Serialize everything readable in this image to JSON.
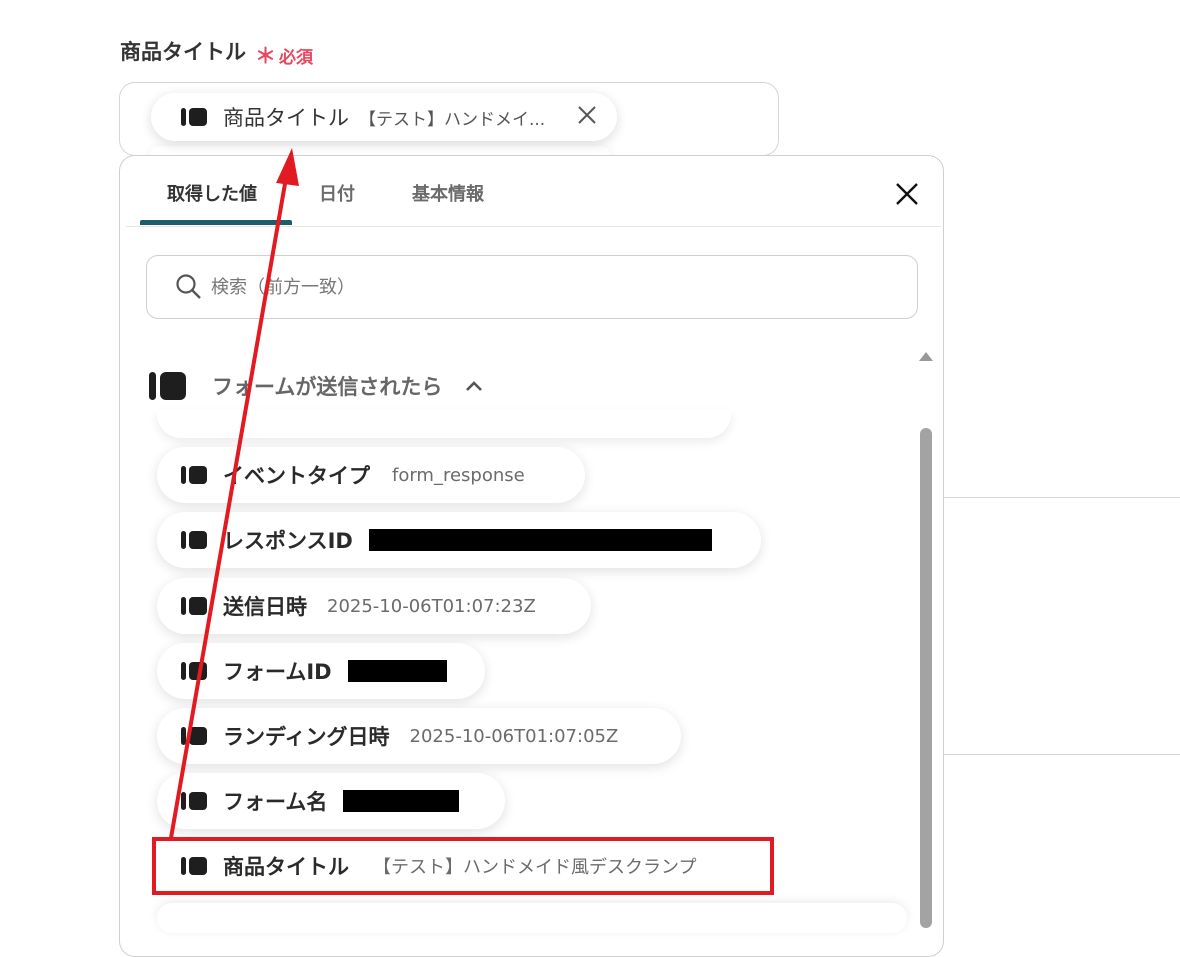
{
  "field": {
    "label": "商品タイトル",
    "required_mark": "＊",
    "required_text": "必須"
  },
  "chip": {
    "label": "商品タイトル",
    "value": "【テスト】ハンドメイ..."
  },
  "panel": {
    "tabs": [
      {
        "label": "取得した値"
      },
      {
        "label": "日付"
      },
      {
        "label": "基本情報"
      }
    ],
    "search": {
      "placeholder": "検索（前方一致）",
      "value": ""
    },
    "group": {
      "title": "フォームが送信されたら"
    },
    "items": [
      {
        "label": "イベントタイプ",
        "value": "form_response"
      },
      {
        "label": "レスポンスID",
        "value": ""
      },
      {
        "label": "送信日時",
        "value": "2025-10-06T01:07:23Z"
      },
      {
        "label": "フォームID",
        "value": ""
      },
      {
        "label": "ランディング日時",
        "value": "2025-10-06T01:07:05Z"
      },
      {
        "label": "フォーム名",
        "value": ""
      },
      {
        "label": "商品タイトル",
        "value": "【テスト】ハンドメイド風デスクランプ"
      }
    ]
  },
  "colors": {
    "required": "#e8475f",
    "tab_underline": "#1c5d6e",
    "annotation": "#e21a22"
  },
  "icons": [
    "close-icon",
    "search-icon",
    "chevron-up-icon",
    "field-bar-icon"
  ]
}
